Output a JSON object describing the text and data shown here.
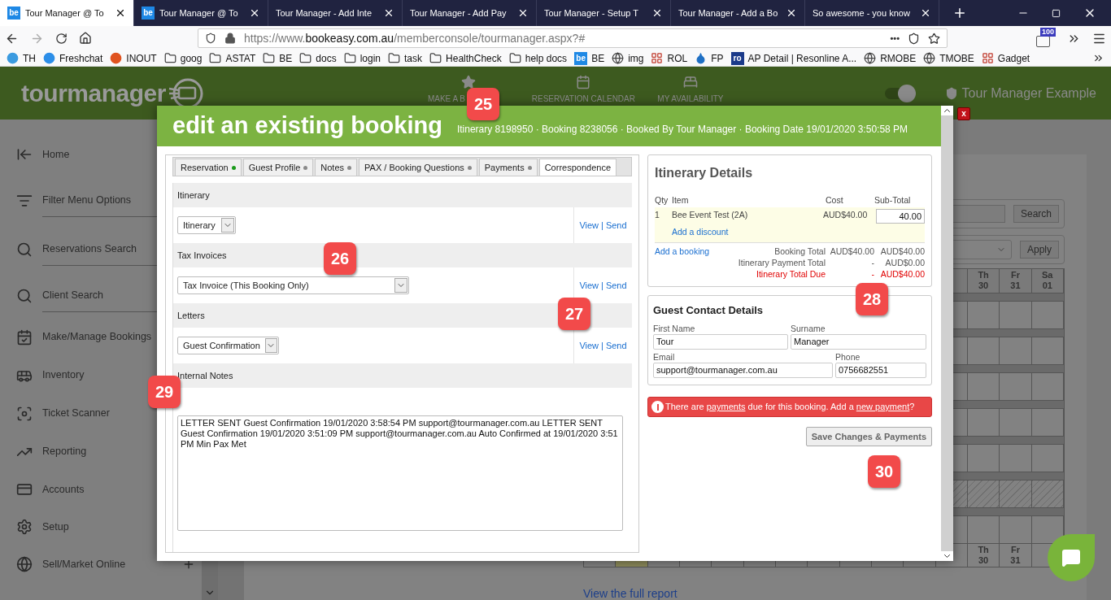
{
  "browser": {
    "tabs": [
      {
        "title": "Tour Manager @ To",
        "icon_label": "be",
        "selected": true
      },
      {
        "title": "Tour Manager @ To",
        "icon_label": "be",
        "selected": false
      },
      {
        "title": "Tour Manager - Add Inte",
        "selected": false
      },
      {
        "title": "Tour Manager - Add Pay",
        "selected": false
      },
      {
        "title": "Tour Manager -  Setup T",
        "selected": false
      },
      {
        "title": "Tour Manager - Add a Bo",
        "selected": false
      },
      {
        "title": "So awesome - you know",
        "selected": false
      }
    ],
    "url": {
      "prefix": "https://www.",
      "host": "bookeasy.com.au",
      "path": "/memberconsole/tourmanager.aspx?#"
    },
    "more_actions": "•••",
    "extension_badge": "100",
    "bookmarks": [
      {
        "label": "TH",
        "kind": "app",
        "color": "#3b9be0"
      },
      {
        "label": "Freshchat",
        "kind": "app",
        "color": "#2c8ee8"
      },
      {
        "label": "INOUT",
        "kind": "app",
        "color": "#e0531f"
      },
      {
        "label": "goog",
        "kind": "folder"
      },
      {
        "label": "ASTAT",
        "kind": "folder"
      },
      {
        "label": "BE",
        "kind": "folder"
      },
      {
        "label": "docs",
        "kind": "folder"
      },
      {
        "label": "login",
        "kind": "folder"
      },
      {
        "label": "task",
        "kind": "folder"
      },
      {
        "label": "HealthCheck",
        "kind": "folder"
      },
      {
        "label": "help docs",
        "kind": "folder"
      },
      {
        "label": "BE",
        "kind": "badge",
        "icon_label": "be",
        "color": "#1e88e5"
      },
      {
        "label": "img",
        "kind": "globe"
      },
      {
        "label": "ROL",
        "kind": "tiles"
      },
      {
        "label": "FP",
        "kind": "drop",
        "color": "#1e6fc4"
      },
      {
        "label": "AP Detail | Resonline A...",
        "kind": "badge",
        "icon_label": "ro",
        "color": "#1b3a8a"
      },
      {
        "label": "RMOBE",
        "kind": "globe"
      },
      {
        "label": "TMOBE",
        "kind": "globe"
      },
      {
        "label": "Gadget",
        "kind": "tiles"
      }
    ]
  },
  "app": {
    "logo": "tourmanager",
    "nav": [
      {
        "label": "MAKE A B",
        "kind": "star"
      },
      {
        "label": "RESERVATION CALENDAR",
        "kind": "calendar"
      },
      {
        "label": "MY AVAILABILITY",
        "kind": "bed"
      }
    ],
    "toggle_on": true,
    "account": "Tour Manager Example",
    "sidebar": [
      {
        "label": "Home",
        "kind": "home",
        "divider": false
      },
      {
        "label": "Filter Menu Options",
        "kind": "filter",
        "divider": true
      },
      {
        "label": "Reservations Search",
        "kind": "search",
        "divider": true
      },
      {
        "label": "Client Search",
        "kind": "search",
        "divider": true
      },
      {
        "label": "Make/Manage Bookings",
        "kind": "calendar",
        "divider": false
      },
      {
        "label": "Inventory",
        "kind": "bus",
        "divider": false
      },
      {
        "label": "Ticket Scanner",
        "kind": "scan",
        "divider": false
      },
      {
        "label": "Reporting",
        "kind": "trend",
        "divider": false
      },
      {
        "label": "Accounts",
        "kind": "card",
        "divider": false
      },
      {
        "label": "Setup",
        "kind": "gear",
        "divider": false
      },
      {
        "label": "Sell/Market Online",
        "kind": "globe",
        "divider": false,
        "expandable": true
      }
    ],
    "search_button": "Search",
    "apply_button": "Apply",
    "calendar_top": [
      {
        "day": "Th",
        "date": "30"
      },
      {
        "day": "Fr",
        "date": "31"
      },
      {
        "day": "Sa",
        "date": "01"
      }
    ],
    "calendar_bottom": [
      {
        "day": "Th",
        "date": "30"
      },
      {
        "day": "Fr",
        "date": "31"
      }
    ],
    "report_link": "View the full report"
  },
  "modal": {
    "title": "edit an existing booking",
    "subtitle": "Itinerary 8198950 · Booking 8238056 · Booked By Tour Manager · Booking Date 19/01/2020 3:50:58 PM",
    "close": "x",
    "tabs": [
      {
        "label": "Reservation",
        "color": "#1a9a1a",
        "selected": false
      },
      {
        "label": "Guest Profile",
        "color": "#8a8a8a",
        "selected": false
      },
      {
        "label": "Notes",
        "color": "#8a8a8a",
        "selected": false
      },
      {
        "label": "PAX / Booking Questions",
        "color": "#8a8a8a",
        "selected": false
      },
      {
        "label": "Payments",
        "color": "#8a8a8a",
        "selected": false
      },
      {
        "label": "Correspondence",
        "selected": true
      }
    ],
    "sections": [
      {
        "heading": "Itinerary",
        "kind": "select",
        "value": "Itinerary",
        "actions": [
          "View",
          "Send"
        ],
        "separator": "|"
      },
      {
        "heading": "Tax Invoices",
        "kind": "select",
        "value": "Tax Invoice (This Booking Only)",
        "actions": [
          "View",
          "Send"
        ],
        "separator": "|"
      },
      {
        "heading": "Letters",
        "kind": "select",
        "value": "Guest Confirmation",
        "actions": [
          "View",
          "Send"
        ],
        "separator": "|"
      },
      {
        "heading": "Internal Notes",
        "kind": "notes",
        "value": "LETTER SENT Guest Confirmation 19/01/2020 3:58:54 PM support@tourmanager.com.au LETTER SENT Guest Confirmation 19/01/2020 3:51:09 PM support@tourmanager.com.au Auto Confirmed at 19/01/2020 3:51 PM Min Pax Met"
      }
    ],
    "itinerary": {
      "title": "Itinerary Details",
      "columns": [
        "Qty",
        "Item",
        "Cost",
        "Sub-Total"
      ],
      "rows": [
        {
          "qty": "1",
          "item": "Bee Event Test (2A)",
          "cost": "AUD$40.00",
          "subtotal": "40.00",
          "discount_link": "Add a discount"
        }
      ],
      "add_booking": "Add a booking",
      "totals": [
        {
          "label": "Booking Total",
          "col_1": "AUD$40.00",
          "col_2": "AUD$40.00",
          "due": false
        },
        {
          "label": "Itinerary Payment Total",
          "col_1": "-",
          "col_2": "AUD$0.00",
          "due": false
        },
        {
          "label": "Itinerary Total Due",
          "col_1": "-",
          "col_2": "AUD$40.00",
          "due": true
        }
      ]
    },
    "contact": {
      "title": "Guest Contact Details",
      "fields": [
        {
          "label": "First Name",
          "value": "Tour"
        },
        {
          "label": "Surname",
          "value": "Manager"
        },
        {
          "label": "Email",
          "value": "support@tourmanager.com.au"
        },
        {
          "label": "Phone",
          "value": "0756682551"
        }
      ]
    },
    "alert": [
      {
        "text": "There are ",
        "link": false
      },
      {
        "text": "payments",
        "link": true
      },
      {
        "text": " due for this booking. Add a ",
        "link": false
      },
      {
        "text": "new payment",
        "link": true
      },
      {
        "text": "?",
        "link": false
      }
    ],
    "save_button": "Save Changes & Payments"
  },
  "callouts": [
    "25",
    "26",
    "27",
    "28",
    "29",
    "30"
  ]
}
